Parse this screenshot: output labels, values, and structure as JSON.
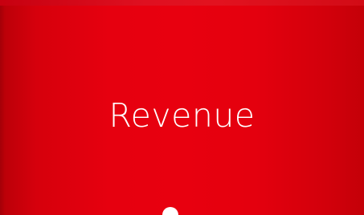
{
  "tile": {
    "title": "Revenue",
    "background_color": "#e8000f",
    "text_color": "#ffffff",
    "indicator_color": "#ffffff"
  }
}
